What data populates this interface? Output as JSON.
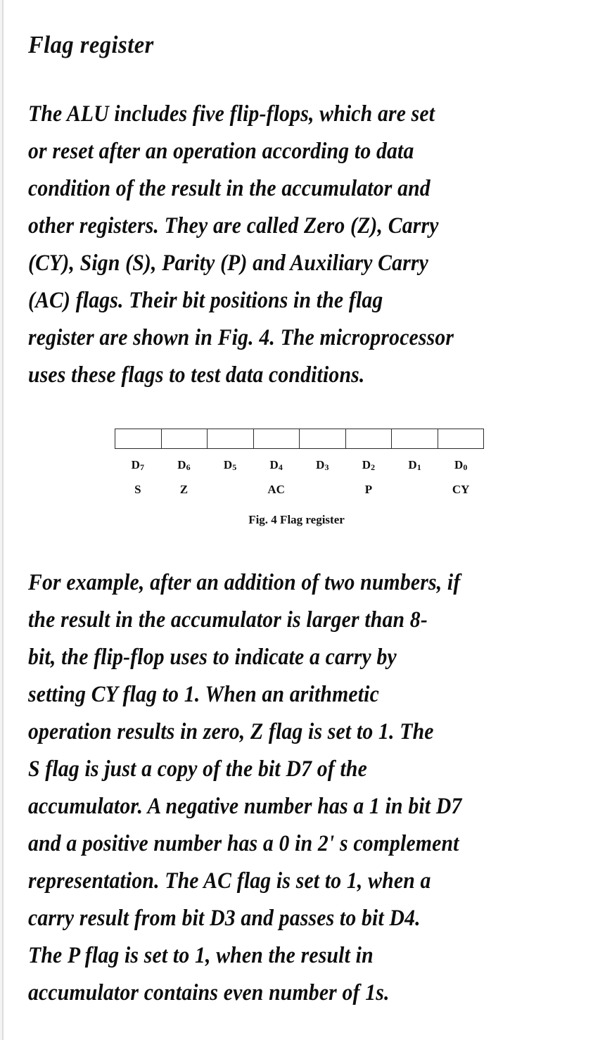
{
  "document": {
    "heading": "Flag register",
    "paragraph_1": [
      "The ALU includes five flip-flops,  which are set",
      "or reset after an operation according to data",
      "condition of the result in the accumulator and",
      "other registers.  They are called Zero (Z),  Carry",
      "(CY),  Sign (S),  Parity (P) and Auxiliary Carry",
      "(AC) flags.  Their bit positions in the flag",
      "register are shown in Fig.  4.  The microprocessor",
      "uses these flags to test data conditions."
    ],
    "paragraph_2": [
      "For example,  after an addition of two numbers,  if",
      "the result in the accumulator is larger than 8-",
      "bit,  the flip-flop uses to indicate a carry by",
      "setting CY flag to 1.  When an arithmetic",
      "operation results in zero,  Z flag is set to 1.  The",
      "S flag is just a copy of the bit D7 of the",
      "accumulator.  A negative number has a 1 in bit D7",
      "and a positive number has a 0 in 2' s complement",
      "representation.  The AC flag is set to 1,  when a",
      "carry result from bit D3 and passes to bit D4.",
      "The P flag is set to 1,  when the result in",
      "accumulator contains even number of 1s."
    ]
  },
  "figure": {
    "caption": "Fig. 4 Flag register",
    "cells": [
      "",
      "",
      "",
      "",
      "",
      "",
      "",
      ""
    ],
    "bit_labels": [
      {
        "base": "D",
        "sub": "7"
      },
      {
        "base": "D",
        "sub": "6"
      },
      {
        "base": "D",
        "sub": "5"
      },
      {
        "base": "D",
        "sub": "4"
      },
      {
        "base": "D",
        "sub": "3"
      },
      {
        "base": "D",
        "sub": "2"
      },
      {
        "base": "D",
        "sub": "1"
      },
      {
        "base": "D",
        "sub": "0"
      }
    ],
    "flag_labels": [
      "S",
      "Z",
      "",
      "AC",
      "",
      "P",
      "",
      "CY"
    ]
  },
  "colors": {
    "page_background": "#ffffff",
    "text": "#0d0d0d",
    "rule": "#2b2b2b",
    "scan_edge": "#dcdcdc"
  }
}
